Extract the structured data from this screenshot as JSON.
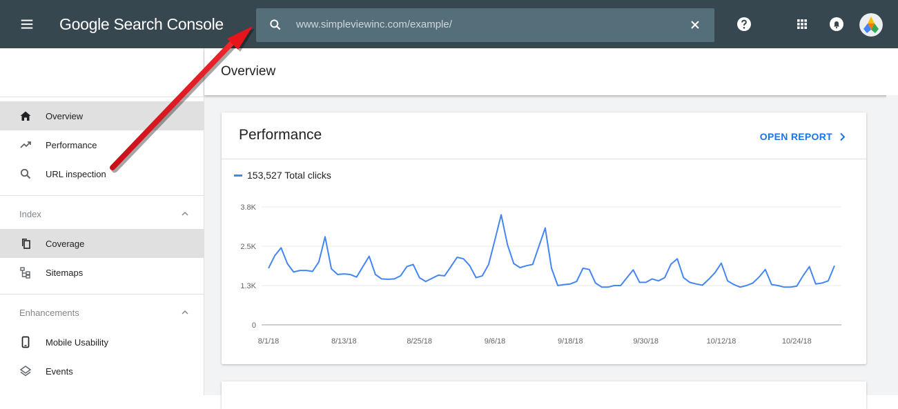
{
  "app": {
    "title": "Google Search Console"
  },
  "search": {
    "value": "www.simpleviewinc.com/example/"
  },
  "topbar_icons": [
    "menu-icon",
    "help-icon",
    "apps-icon",
    "notifications-icon",
    "avatar"
  ],
  "sidebar": {
    "items": [
      {
        "label": "Overview",
        "icon": "home-icon",
        "active": true
      },
      {
        "label": "Performance",
        "icon": "trending-icon"
      },
      {
        "label": "URL inspection",
        "icon": "search-icon"
      }
    ],
    "index": {
      "header": "Index",
      "items": [
        {
          "label": "Coverage",
          "icon": "copy-icon",
          "active": true
        },
        {
          "label": "Sitemaps",
          "icon": "sitemap-icon"
        }
      ]
    },
    "enhancements": {
      "header": "Enhancements",
      "items": [
        {
          "label": "Mobile Usability",
          "icon": "phone-icon"
        },
        {
          "label": "Events",
          "icon": "layers-icon"
        }
      ]
    }
  },
  "main": {
    "page_title": "Overview",
    "performance": {
      "title": "Performance",
      "open_report": "OPEN REPORT",
      "legend": "153,527 Total clicks"
    }
  },
  "colors": {
    "topbar": "#37474f",
    "accent": "#1a73e8",
    "series": "#4285f4",
    "annotation_arrow": "#e8141b"
  },
  "chart_data": {
    "type": "line",
    "ytick_labels": [
      "0",
      "1.3K",
      "2.5K",
      "3.8K"
    ],
    "yticks": [
      0,
      1250,
      2500,
      3750
    ],
    "ylim": [
      0,
      3750
    ],
    "xtick_labels": [
      "8/1/18",
      "8/13/18",
      "8/25/18",
      "9/6/18",
      "9/18/18",
      "9/30/18",
      "10/12/18",
      "10/24/18"
    ],
    "xtick_index": [
      0,
      12,
      24,
      36,
      48,
      60,
      72,
      84
    ],
    "grid": true,
    "series": [
      {
        "name": "Total clicks",
        "values": [
          1800,
          2200,
          2450,
          1950,
          1680,
          1730,
          1730,
          1700,
          2000,
          2800,
          1780,
          1600,
          1620,
          1600,
          1520,
          1850,
          2180,
          1600,
          1460,
          1450,
          1460,
          1560,
          1850,
          1920,
          1500,
          1380,
          1480,
          1580,
          1560,
          1850,
          2150,
          2100,
          1880,
          1500,
          1560,
          1920,
          2700,
          3500,
          2550,
          1950,
          1820,
          1880,
          1920,
          2500,
          3080,
          1800,
          1250,
          1280,
          1300,
          1380,
          1800,
          1760,
          1330,
          1200,
          1200,
          1250,
          1250,
          1500,
          1750,
          1350,
          1350,
          1460,
          1400,
          1500,
          1930,
          2100,
          1500,
          1350,
          1300,
          1260,
          1450,
          1660,
          1960,
          1400,
          1280,
          1200,
          1250,
          1330,
          1520,
          1760,
          1280,
          1250,
          1200,
          1200,
          1230,
          1560,
          1850,
          1300,
          1330,
          1400,
          1880
        ]
      }
    ]
  }
}
